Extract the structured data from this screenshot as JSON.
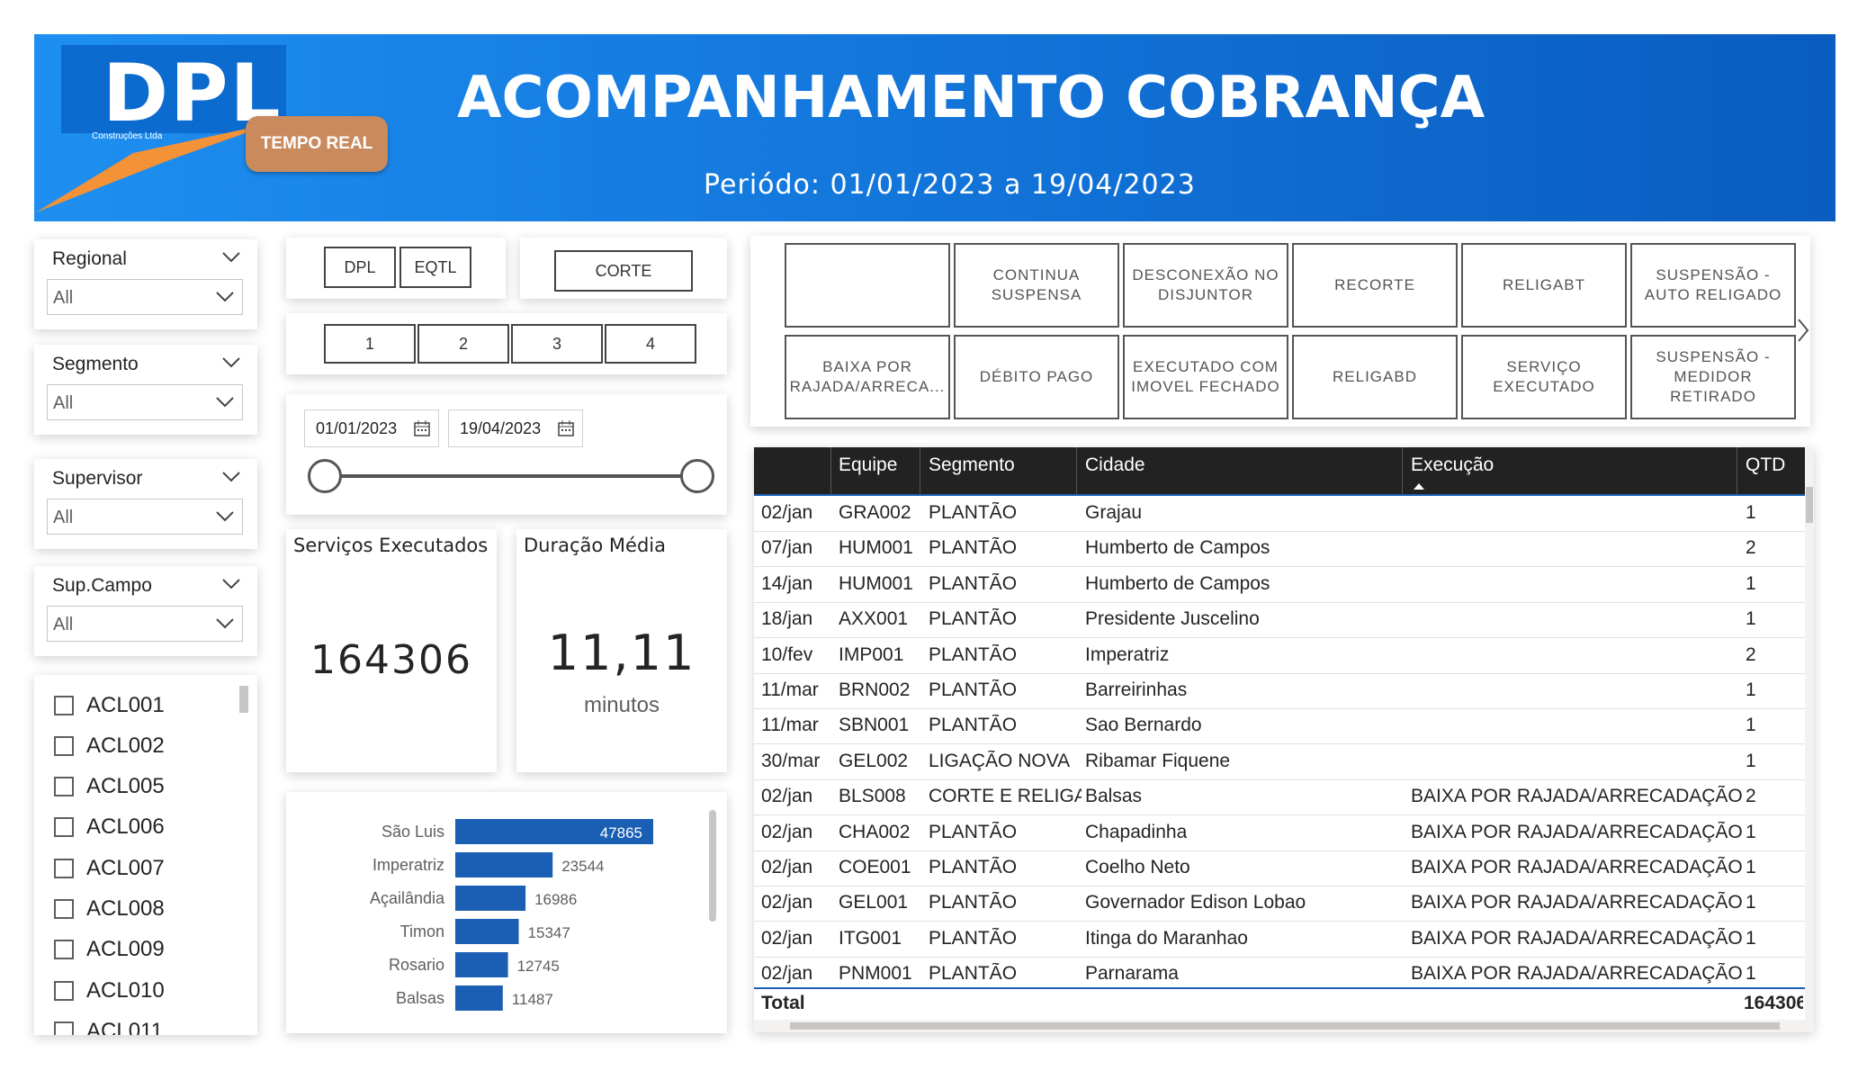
{
  "header": {
    "logo_text": "DPL",
    "logo_sub": "Construções Ltda",
    "title": "ACOMPANHAMENTO COBRANÇA",
    "period": "Periódo: 01/01/2023 a 19/04/2023",
    "realtime_label": "TEMPO REAL"
  },
  "colors": {
    "header_start": "#1e8ff0",
    "header_end": "#0a5cc0",
    "accent_bar": "#1b5fb5",
    "realtime_btn": "#c98a5e"
  },
  "slicers": [
    {
      "title": "Regional",
      "value": "All"
    },
    {
      "title": "Segmento",
      "value": "All"
    },
    {
      "title": "Supervisor",
      "value": "All"
    },
    {
      "title": "Sup.Campo",
      "value": "All"
    }
  ],
  "checklist": [
    "ACL001",
    "ACL002",
    "ACL005",
    "ACL006",
    "ACL007",
    "ACL008",
    "ACL009",
    "ACL010",
    "ACL011"
  ],
  "company_buttons": [
    "DPL",
    "EQTL"
  ],
  "corte_button": "CORTE",
  "number_buttons": [
    "1",
    "2",
    "3",
    "4"
  ],
  "date_range": {
    "start": "01/01/2023",
    "end": "19/04/2023"
  },
  "kpis": {
    "servicos_title": "Serviços Executados",
    "servicos_value": "164306",
    "duracao_title": "Duração Média",
    "duracao_value": "11,11",
    "duracao_unit": "minutos"
  },
  "tiles_row1": [
    "",
    "CONTINUA SUSPENSA",
    "DESCONEXÃO NO DISJUNTOR",
    "RECORTE",
    "RELIGABT",
    "SUSPENSÃO - AUTO RELIGADO"
  ],
  "tiles_row2": [
    "BAIXA POR RAJADA/ARRECA...",
    "DÉBITO PAGO",
    "EXECUTADO COM IMOVEL FECHADO",
    "RELIGABD",
    "SERVIÇO EXECUTADO",
    "SUSPENSÃO - MEDIDOR RETIRADO"
  ],
  "table": {
    "headers": [
      "",
      "Equipe",
      "Segmento",
      "Cidade",
      "Execução",
      "QTD"
    ],
    "rows": [
      [
        "02/jan",
        "GRA002",
        "PLANTÃO",
        "Grajau",
        "",
        "1"
      ],
      [
        "07/jan",
        "HUM001",
        "PLANTÃO",
        "Humberto de Campos",
        "",
        "2"
      ],
      [
        "14/jan",
        "HUM001",
        "PLANTÃO",
        "Humberto de Campos",
        "",
        "1"
      ],
      [
        "18/jan",
        "AXX001",
        "PLANTÃO",
        "Presidente Juscelino",
        "",
        "1"
      ],
      [
        "10/fev",
        "IMP001",
        "PLANTÃO",
        "Imperatriz",
        "",
        "2"
      ],
      [
        "11/mar",
        "BRN002",
        "PLANTÃO",
        "Barreirinhas",
        "",
        "1"
      ],
      [
        "11/mar",
        "SBN001",
        "PLANTÃO",
        "Sao Bernardo",
        "",
        "1"
      ],
      [
        "30/mar",
        "GEL002",
        "LIGAÇÃO NOVA",
        "Ribamar Fiquene",
        "",
        "1"
      ],
      [
        "02/jan",
        "BLS008",
        "CORTE E RELIGA",
        "Balsas",
        "BAIXA POR RAJADA/ARRECADAÇÃO",
        "2"
      ],
      [
        "02/jan",
        "CHA002",
        "PLANTÃO",
        "Chapadinha",
        "BAIXA POR RAJADA/ARRECADAÇÃO",
        "1"
      ],
      [
        "02/jan",
        "COE001",
        "PLANTÃO",
        "Coelho Neto",
        "BAIXA POR RAJADA/ARRECADAÇÃO",
        "1"
      ],
      [
        "02/jan",
        "GEL001",
        "PLANTÃO",
        "Governador Edison Lobao",
        "BAIXA POR RAJADA/ARRECADAÇÃO",
        "1"
      ],
      [
        "02/jan",
        "ITG001",
        "PLANTÃO",
        "Itinga do Maranhao",
        "BAIXA POR RAJADA/ARRECADAÇÃO",
        "1"
      ],
      [
        "02/jan",
        "PNM001",
        "PLANTÃO",
        "Parnarama",
        "BAIXA POR RAJADA/ARRECADAÇÃO",
        "1"
      ]
    ],
    "total_label": "Total",
    "total_value": "164306"
  },
  "chart_data": {
    "type": "bar",
    "orientation": "horizontal",
    "categories": [
      "São Luis",
      "Imperatriz",
      "Açailândia",
      "Timon",
      "Rosario",
      "Balsas"
    ],
    "values": [
      47865,
      23544,
      16986,
      15347,
      12745,
      11487
    ]
  }
}
